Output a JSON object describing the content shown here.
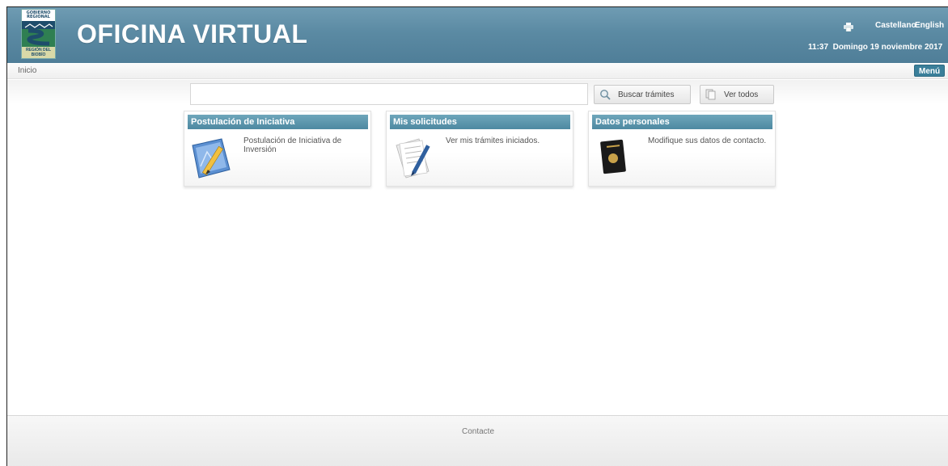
{
  "header": {
    "logo_top": "GOBIERNO REGIONAL",
    "logo_bottom": "REGIÓN DEL BIOBÍO",
    "title": "OFICINA VIRTUAL",
    "languages": [
      "Castellano",
      "English"
    ],
    "time": "11:37",
    "date": "Domingo 19 noviembre 2017",
    "icons": {
      "print": "printer-icon"
    }
  },
  "breadcrumb": {
    "home": "Inicio"
  },
  "menu_label": "Menú",
  "search": {
    "value": "",
    "placeholder": "",
    "button_label": "Buscar trámites",
    "view_all_label": "Ver todos",
    "icons": {
      "search": "magnifier-icon",
      "view_all": "documents-icon"
    }
  },
  "cards": [
    {
      "title": "Postulación de Iniciativa",
      "text": "Postulación de Iniciativa de Inversión",
      "icon": "blueprint-pencil-icon"
    },
    {
      "title": "Mis solicitudes",
      "text": "Ver mis trámites iniciados.",
      "icon": "document-pen-icon"
    },
    {
      "title": "Datos personales",
      "text": "Modifique sus datos de contacto.",
      "icon": "passport-icon"
    }
  ],
  "footer": {
    "contact": "Contacte"
  },
  "colors": {
    "header": "#5b8aa3",
    "card_header": "#4d89a1",
    "menu_button": "#3a7f9a"
  }
}
